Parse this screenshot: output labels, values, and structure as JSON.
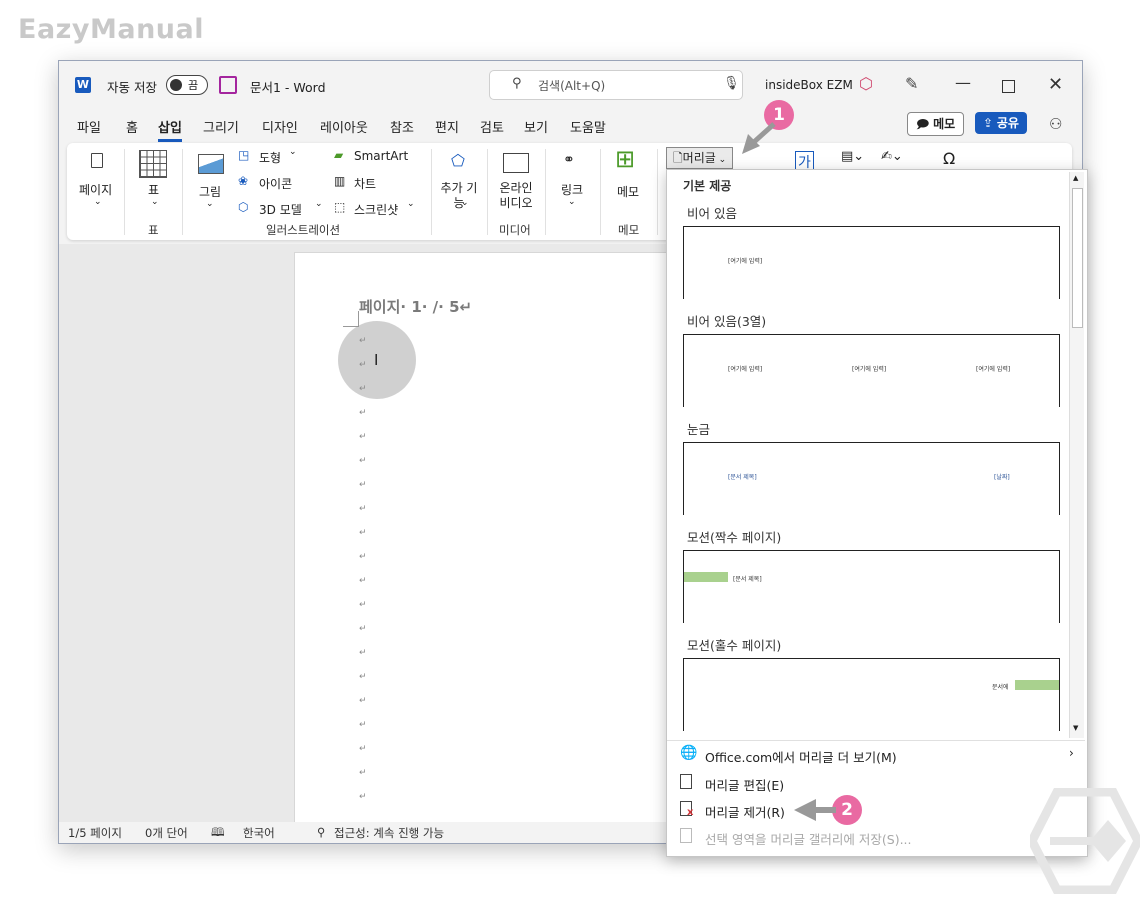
{
  "watermark": "EazyManual",
  "titlebar": {
    "autosave_label": "자동 저장",
    "autosave_state": "끔",
    "doc_title": "문서1 - Word",
    "search_placeholder": "검색(Alt+Q)",
    "user_name": "insideBox EZM"
  },
  "menu_tabs": [
    "파일",
    "홈",
    "삽입",
    "그리기",
    "디자인",
    "레이아웃",
    "참조",
    "편지",
    "검토",
    "보기",
    "도움말"
  ],
  "active_tab": "삽입",
  "header_buttons": {
    "memo": "메모",
    "share": "공유"
  },
  "ribbon": {
    "page": "페이지",
    "table": "표",
    "table_group": "표",
    "picture": "그림",
    "shapes": "도형",
    "icons": "아이콘",
    "model3d": "3D 모델",
    "smartart": "SmartArt",
    "chart": "차트",
    "screenshot": "스크린샷",
    "illustrations_group": "일러스트레이션",
    "addins": "추가 기능",
    "online_video": "온라인 비디오",
    "media_group": "미디어",
    "link": "링크",
    "memo": "메모",
    "memo_group": "메모",
    "header_button": "머리글"
  },
  "document": {
    "header_text": "페이지· 1· /· 5↵",
    "paragraph_mark": "↵"
  },
  "statusbar": {
    "page": "1/5 페이지",
    "words": "0개 단어",
    "language": "한국어",
    "accessibility": "접근성: 계속 진행 가능"
  },
  "header_gallery": {
    "section_title": "기본 제공",
    "items": [
      {
        "name": "비어 있음",
        "placeholders": [
          "[여기에 입력]"
        ]
      },
      {
        "name": "비어 있음(3열)",
        "placeholders": [
          "[여기에 입력]",
          "[여기에 입력]",
          "[여기에 입력]"
        ]
      },
      {
        "name": "눈금",
        "placeholders": [
          "[문서 제목]",
          "[날짜]"
        ]
      },
      {
        "name": "모션(짝수 페이지)",
        "placeholders": [
          "[문서 제목]"
        ]
      },
      {
        "name": "모션(홀수 페이지)",
        "placeholders": [
          "문서에"
        ]
      }
    ],
    "menu": [
      {
        "label": "Office.com에서 머리글 더 보기(M)",
        "disabled": false
      },
      {
        "label": "머리글 편집(E)",
        "disabled": false
      },
      {
        "label": "머리글 제거(R)",
        "disabled": false
      },
      {
        "label": "선택 영역을 머리글 갤러리에 저장(S)...",
        "disabled": true
      }
    ]
  },
  "annotations": {
    "step1": "1",
    "step2": "2"
  },
  "colors": {
    "accent": "#185abd",
    "badge": "#e96aa2",
    "motion_bar": "#a9d18e",
    "save_icon": "#a4259e"
  }
}
